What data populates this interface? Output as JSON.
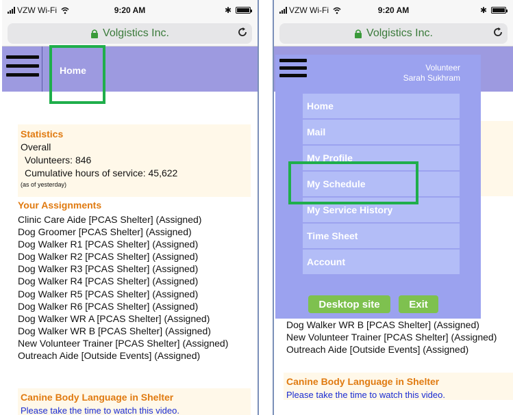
{
  "status": {
    "carrier": "VZW Wi-Fi",
    "time": "9:20 AM"
  },
  "browser": {
    "site": "Volgistics Inc.",
    "reload_glyph": "C"
  },
  "left": {
    "header_title": "Home",
    "statistics": {
      "title": "Statistics",
      "overall": "Overall",
      "volunteers": "Volunteers: 846",
      "hours": "Cumulative hours of service: 45,622",
      "as_of": "(as of yesterday)"
    },
    "assignments_title": "Your Assignments",
    "assignments": [
      "Clinic Care Aide [PCAS Shelter] (Assigned)",
      "Dog Groomer [PCAS Shelter] (Assigned)",
      "Dog Walker R1 [PCAS Shelter] (Assigned)",
      "Dog Walker R2 [PCAS Shelter] (Assigned)",
      "Dog Walker R3 [PCAS Shelter] (Assigned)",
      "Dog Walker R4 [PCAS Shelter] (Assigned)",
      "Dog Walker R5 [PCAS Shelter] (Assigned)",
      "Dog Walker R6 [PCAS Shelter] (Assigned)",
      "Dog Walker WR A [PCAS Shelter] (Assigned)",
      "Dog Walker WR B [PCAS Shelter] (Assigned)",
      "New Volunteer Trainer [PCAS Shelter] (Assigned)",
      "Outreach Aide [Outside Events] (Assigned)"
    ],
    "news_title": "Canine Body Language in Shelter",
    "news_text": "Please take the time to watch this video."
  },
  "right": {
    "user_role": "Volunteer",
    "user_name": "Sarah Sukhram",
    "menu": [
      "Home",
      "Mail",
      "My Profile",
      "My Schedule",
      "My Service History",
      "Time Sheet",
      "Account"
    ],
    "desktop_button": "Desktop site",
    "exit_button": "Exit",
    "assignments_visible": [
      "Dog Walker WR B [PCAS Shelter] (Assigned)",
      "New Volunteer Trainer [PCAS Shelter] (Assigned)",
      "Outreach Aide [Outside Events] (Assigned)"
    ],
    "news_title": "Canine Body Language in Shelter",
    "news_text": "Please take the time to watch this video."
  },
  "colors": {
    "header": "#9d9ae0",
    "menu_panel": "#9ba2ef",
    "menu_item": "#b3bdf7",
    "accent_orange": "#e07a10",
    "highlight_green": "#1fae4b",
    "button_green": "#7ec14f",
    "link_blue": "#1a2bd1"
  },
  "icons": [
    "signal-bars-icon",
    "wifi-icon",
    "bluetooth-icon",
    "battery-icon",
    "lock-icon",
    "reload-icon",
    "hamburger-menu-icon"
  ]
}
